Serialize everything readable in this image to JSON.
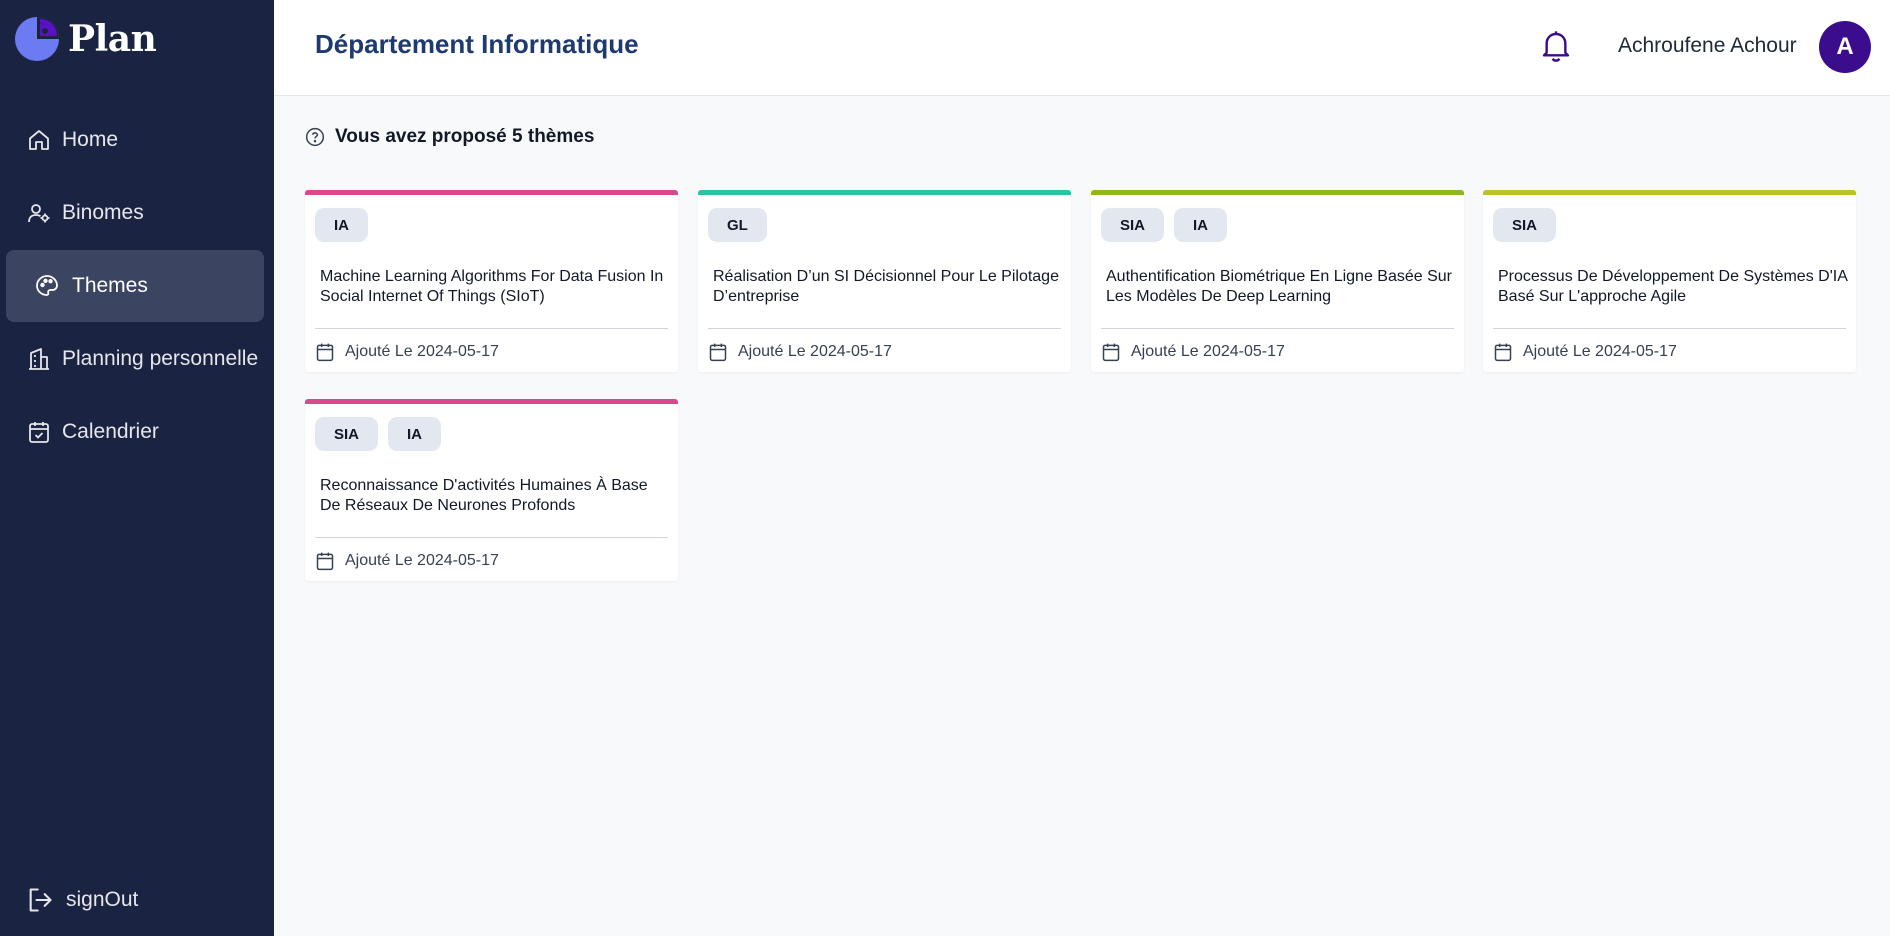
{
  "app": {
    "name": "Plan"
  },
  "sidebar": {
    "items": [
      {
        "label": "Home"
      },
      {
        "label": "Binomes"
      },
      {
        "label": "Themes"
      },
      {
        "label": "Planning personnelle"
      },
      {
        "label": "Calendrier"
      }
    ],
    "active": "Themes",
    "signout_label": "signOut"
  },
  "header": {
    "title": "Département Informatique",
    "user_name": "Achroufene Achour",
    "avatar_initial": "A"
  },
  "summary": {
    "text": "Vous avez proposé 5 thèmes"
  },
  "themes": [
    {
      "accent": "#d94a8c",
      "tags": [
        "IA"
      ],
      "title": "Machine Learning Algorithms For Data Fusion In Social Internet Of Things (SIoT)",
      "date": "Ajouté Le 2024-05-17"
    },
    {
      "accent": "#2cc3a3",
      "tags": [
        "GL"
      ],
      "title": "Réalisation D’un SI Décisionnel Pour Le Pilotage D’entreprise",
      "date": "Ajouté Le 2024-05-17"
    },
    {
      "accent": "#8fb81e",
      "tags": [
        "SIA",
        "IA"
      ],
      "title": "Authentification Biométrique En Ligne Basée Sur Les Modèles De Deep Learning",
      "date": "Ajouté Le 2024-05-17"
    },
    {
      "accent": "#b9c42a",
      "tags": [
        "SIA"
      ],
      "title": "Processus De Développement De Systèmes D'IA Basé Sur L'approche Agile",
      "date": "Ajouté Le 2024-05-17"
    },
    {
      "accent": "#d94a8c",
      "tags": [
        "SIA",
        "IA"
      ],
      "title": "Reconnaissance D'activités Humaines À Base De Réseaux De Neurones Profonds",
      "date": "Ajouté Le 2024-05-17"
    }
  ],
  "colors": {
    "sidebar_bg": "#1a2341",
    "active_item_bg": "#3b4562",
    "title_color": "#1e3a6e",
    "avatar_bg": "#3b0d8c",
    "bell_color": "#3b0d8c"
  },
  "icons": [
    "logo-icon",
    "home-icon",
    "users-gear-icon",
    "palette-icon",
    "building-icon",
    "calendar-check-icon",
    "logout-icon",
    "bell-icon",
    "help-circle-icon",
    "calendar-icon"
  ]
}
